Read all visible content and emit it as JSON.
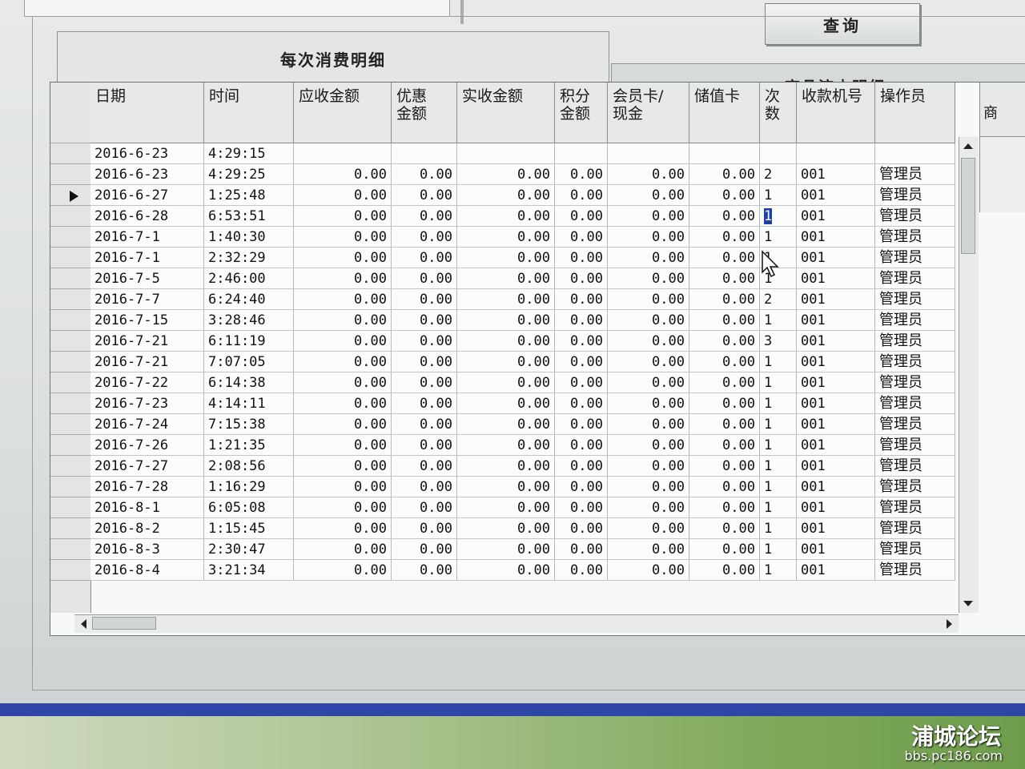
{
  "toolbar": {
    "query_label": "查询"
  },
  "tabs": [
    {
      "label": "每次消费明细",
      "active": true
    },
    {
      "label": "商品流水明细",
      "active": false
    }
  ],
  "columns": [
    "日期",
    "时间",
    "应收金额",
    "优惠\n金额",
    "实收金额",
    "积分\n金额",
    "会员卡/\n现金",
    "储值卡",
    "次数",
    "收款机号",
    "操作员"
  ],
  "side_panel_header": "商",
  "rows": [
    [
      "2016-6-23",
      "4:29:15",
      "",
      "",
      "",
      "",
      "",
      "",
      "",
      "",
      ""
    ],
    [
      "2016-6-23",
      "4:29:25",
      "0.00",
      "0.00",
      "0.00",
      "0.00",
      "0.00",
      "0.00",
      "2",
      "001",
      "管理员"
    ],
    [
      "2016-6-27",
      "1:25:48",
      "0.00",
      "0.00",
      "0.00",
      "0.00",
      "0.00",
      "0.00",
      "1",
      "001",
      "管理员"
    ],
    [
      "2016-6-28",
      "6:53:51",
      "0.00",
      "0.00",
      "0.00",
      "0.00",
      "0.00",
      "0.00",
      "1",
      "001",
      "管理员"
    ],
    [
      "2016-7-1",
      "1:40:30",
      "0.00",
      "0.00",
      "0.00",
      "0.00",
      "0.00",
      "0.00",
      "1",
      "001",
      "管理员"
    ],
    [
      "2016-7-1",
      "2:32:29",
      "0.00",
      "0.00",
      "0.00",
      "0.00",
      "0.00",
      "0.00",
      "1",
      "001",
      "管理员"
    ],
    [
      "2016-7-5",
      "2:46:00",
      "0.00",
      "0.00",
      "0.00",
      "0.00",
      "0.00",
      "0.00",
      "1",
      "001",
      "管理员"
    ],
    [
      "2016-7-7",
      "6:24:40",
      "0.00",
      "0.00",
      "0.00",
      "0.00",
      "0.00",
      "0.00",
      "2",
      "001",
      "管理员"
    ],
    [
      "2016-7-15",
      "3:28:46",
      "0.00",
      "0.00",
      "0.00",
      "0.00",
      "0.00",
      "0.00",
      "1",
      "001",
      "管理员"
    ],
    [
      "2016-7-21",
      "6:11:19",
      "0.00",
      "0.00",
      "0.00",
      "0.00",
      "0.00",
      "0.00",
      "3",
      "001",
      "管理员"
    ],
    [
      "2016-7-21",
      "7:07:05",
      "0.00",
      "0.00",
      "0.00",
      "0.00",
      "0.00",
      "0.00",
      "1",
      "001",
      "管理员"
    ],
    [
      "2016-7-22",
      "6:14:38",
      "0.00",
      "0.00",
      "0.00",
      "0.00",
      "0.00",
      "0.00",
      "1",
      "001",
      "管理员"
    ],
    [
      "2016-7-23",
      "4:14:11",
      "0.00",
      "0.00",
      "0.00",
      "0.00",
      "0.00",
      "0.00",
      "1",
      "001",
      "管理员"
    ],
    [
      "2016-7-24",
      "7:15:38",
      "0.00",
      "0.00",
      "0.00",
      "0.00",
      "0.00",
      "0.00",
      "1",
      "001",
      "管理员"
    ],
    [
      "2016-7-26",
      "1:21:35",
      "0.00",
      "0.00",
      "0.00",
      "0.00",
      "0.00",
      "0.00",
      "1",
      "001",
      "管理员"
    ],
    [
      "2016-7-27",
      "2:08:56",
      "0.00",
      "0.00",
      "0.00",
      "0.00",
      "0.00",
      "0.00",
      "1",
      "001",
      "管理员"
    ],
    [
      "2016-7-28",
      "1:16:29",
      "0.00",
      "0.00",
      "0.00",
      "0.00",
      "0.00",
      "0.00",
      "1",
      "001",
      "管理员"
    ],
    [
      "2016-8-1",
      "6:05:08",
      "0.00",
      "0.00",
      "0.00",
      "0.00",
      "0.00",
      "0.00",
      "1",
      "001",
      "管理员"
    ],
    [
      "2016-8-2",
      "1:15:45",
      "0.00",
      "0.00",
      "0.00",
      "0.00",
      "0.00",
      "0.00",
      "1",
      "001",
      "管理员"
    ],
    [
      "2016-8-3",
      "2:30:47",
      "0.00",
      "0.00",
      "0.00",
      "0.00",
      "0.00",
      "0.00",
      "1",
      "001",
      "管理员"
    ],
    [
      "2016-8-4",
      "3:21:34",
      "0.00",
      "0.00",
      "0.00",
      "0.00",
      "0.00",
      "0.00",
      "1",
      "001",
      "管理员"
    ]
  ],
  "current_row_index": 2,
  "selected_cell": {
    "row": 3,
    "col": 8
  },
  "watermark": {
    "title": "浦城论坛",
    "url": "bbs.pc186.com"
  }
}
